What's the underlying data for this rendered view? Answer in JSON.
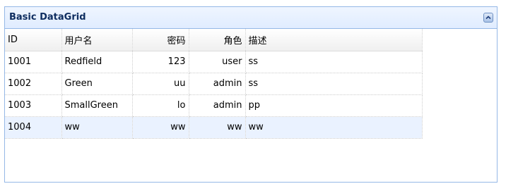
{
  "panel": {
    "title": "Basic DataGrid",
    "collapse_icon": "collapse-up-icon"
  },
  "grid": {
    "columns": [
      "ID",
      "用户名",
      "密码",
      "角色",
      "描述"
    ],
    "rows": [
      [
        "1001",
        "Redfield",
        "123",
        "user",
        "ss"
      ],
      [
        "1002",
        "Green",
        "uu",
        "admin",
        "ss"
      ],
      [
        "1003",
        "SmallGreen",
        "lo",
        "admin",
        "pp"
      ],
      [
        "1004",
        "ww",
        "ww",
        "ww",
        "ww"
      ]
    ],
    "highlighted_row_index": 3,
    "colors": {
      "border": "#95b8e7",
      "title": "#0e2d5f",
      "highlight": "#eaf2ff"
    }
  }
}
